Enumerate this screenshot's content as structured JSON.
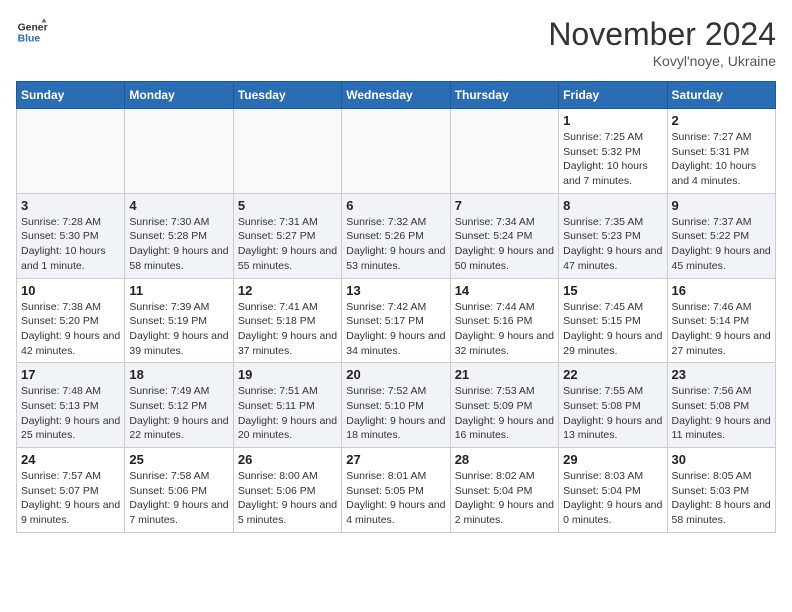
{
  "header": {
    "logo": {
      "general": "General",
      "blue": "Blue"
    },
    "month": "November 2024",
    "location": "Kovyl'noye, Ukraine"
  },
  "weekdays": [
    "Sunday",
    "Monday",
    "Tuesday",
    "Wednesday",
    "Thursday",
    "Friday",
    "Saturday"
  ],
  "weeks": [
    [
      {
        "day": "",
        "info": ""
      },
      {
        "day": "",
        "info": ""
      },
      {
        "day": "",
        "info": ""
      },
      {
        "day": "",
        "info": ""
      },
      {
        "day": "",
        "info": ""
      },
      {
        "day": "1",
        "info": "Sunrise: 7:25 AM\nSunset: 5:32 PM\nDaylight: 10 hours and 7 minutes."
      },
      {
        "day": "2",
        "info": "Sunrise: 7:27 AM\nSunset: 5:31 PM\nDaylight: 10 hours and 4 minutes."
      }
    ],
    [
      {
        "day": "3",
        "info": "Sunrise: 7:28 AM\nSunset: 5:30 PM\nDaylight: 10 hours and 1 minute."
      },
      {
        "day": "4",
        "info": "Sunrise: 7:30 AM\nSunset: 5:28 PM\nDaylight: 9 hours and 58 minutes."
      },
      {
        "day": "5",
        "info": "Sunrise: 7:31 AM\nSunset: 5:27 PM\nDaylight: 9 hours and 55 minutes."
      },
      {
        "day": "6",
        "info": "Sunrise: 7:32 AM\nSunset: 5:26 PM\nDaylight: 9 hours and 53 minutes."
      },
      {
        "day": "7",
        "info": "Sunrise: 7:34 AM\nSunset: 5:24 PM\nDaylight: 9 hours and 50 minutes."
      },
      {
        "day": "8",
        "info": "Sunrise: 7:35 AM\nSunset: 5:23 PM\nDaylight: 9 hours and 47 minutes."
      },
      {
        "day": "9",
        "info": "Sunrise: 7:37 AM\nSunset: 5:22 PM\nDaylight: 9 hours and 45 minutes."
      }
    ],
    [
      {
        "day": "10",
        "info": "Sunrise: 7:38 AM\nSunset: 5:20 PM\nDaylight: 9 hours and 42 minutes."
      },
      {
        "day": "11",
        "info": "Sunrise: 7:39 AM\nSunset: 5:19 PM\nDaylight: 9 hours and 39 minutes."
      },
      {
        "day": "12",
        "info": "Sunrise: 7:41 AM\nSunset: 5:18 PM\nDaylight: 9 hours and 37 minutes."
      },
      {
        "day": "13",
        "info": "Sunrise: 7:42 AM\nSunset: 5:17 PM\nDaylight: 9 hours and 34 minutes."
      },
      {
        "day": "14",
        "info": "Sunrise: 7:44 AM\nSunset: 5:16 PM\nDaylight: 9 hours and 32 minutes."
      },
      {
        "day": "15",
        "info": "Sunrise: 7:45 AM\nSunset: 5:15 PM\nDaylight: 9 hours and 29 minutes."
      },
      {
        "day": "16",
        "info": "Sunrise: 7:46 AM\nSunset: 5:14 PM\nDaylight: 9 hours and 27 minutes."
      }
    ],
    [
      {
        "day": "17",
        "info": "Sunrise: 7:48 AM\nSunset: 5:13 PM\nDaylight: 9 hours and 25 minutes."
      },
      {
        "day": "18",
        "info": "Sunrise: 7:49 AM\nSunset: 5:12 PM\nDaylight: 9 hours and 22 minutes."
      },
      {
        "day": "19",
        "info": "Sunrise: 7:51 AM\nSunset: 5:11 PM\nDaylight: 9 hours and 20 minutes."
      },
      {
        "day": "20",
        "info": "Sunrise: 7:52 AM\nSunset: 5:10 PM\nDaylight: 9 hours and 18 minutes."
      },
      {
        "day": "21",
        "info": "Sunrise: 7:53 AM\nSunset: 5:09 PM\nDaylight: 9 hours and 16 minutes."
      },
      {
        "day": "22",
        "info": "Sunrise: 7:55 AM\nSunset: 5:08 PM\nDaylight: 9 hours and 13 minutes."
      },
      {
        "day": "23",
        "info": "Sunrise: 7:56 AM\nSunset: 5:08 PM\nDaylight: 9 hours and 11 minutes."
      }
    ],
    [
      {
        "day": "24",
        "info": "Sunrise: 7:57 AM\nSunset: 5:07 PM\nDaylight: 9 hours and 9 minutes."
      },
      {
        "day": "25",
        "info": "Sunrise: 7:58 AM\nSunset: 5:06 PM\nDaylight: 9 hours and 7 minutes."
      },
      {
        "day": "26",
        "info": "Sunrise: 8:00 AM\nSunset: 5:06 PM\nDaylight: 9 hours and 5 minutes."
      },
      {
        "day": "27",
        "info": "Sunrise: 8:01 AM\nSunset: 5:05 PM\nDaylight: 9 hours and 4 minutes."
      },
      {
        "day": "28",
        "info": "Sunrise: 8:02 AM\nSunset: 5:04 PM\nDaylight: 9 hours and 2 minutes."
      },
      {
        "day": "29",
        "info": "Sunrise: 8:03 AM\nSunset: 5:04 PM\nDaylight: 9 hours and 0 minutes."
      },
      {
        "day": "30",
        "info": "Sunrise: 8:05 AM\nSunset: 5:03 PM\nDaylight: 8 hours and 58 minutes."
      }
    ]
  ]
}
